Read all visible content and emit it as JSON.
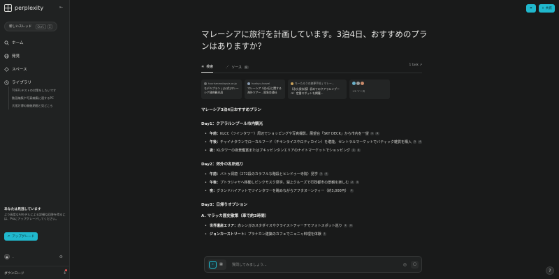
{
  "app": {
    "name": "perplexity"
  },
  "sidebar": {
    "new_thread": {
      "label": "新しいスレッド",
      "kbd": [
        "Ctrl",
        "I"
      ]
    },
    "nav": [
      {
        "label": "ホーム",
        "icon": "search-icon"
      },
      {
        "label": "発見",
        "icon": "globe-icon"
      },
      {
        "label": "スペース",
        "icon": "spaces-icon"
      },
      {
        "label": "ライブラリ",
        "icon": "library-icon"
      }
    ],
    "library_items": [
      "TOEFLテストの対策をしたいです",
      "動画編集や写真編集に適するPC",
      "大阪万博の開催期間と見どころ"
    ],
    "promo": {
      "title": "あなたは見逃しています",
      "body": "より高度なAIモデルによる詳細な回答を得るには、Proにアップグレードしてください。",
      "button": "アップグレード"
    },
    "download_label": "ダウンロード"
  },
  "header": {
    "share_label": "共有"
  },
  "thread": {
    "question": "マレーシアに旅行を計画しています。3泊4日、おすすめのプランはありますか？",
    "tabs": [
      {
        "label": "検索",
        "active": true
      },
      {
        "label": "ソース",
        "count": "8",
        "active": false
      }
    ],
    "tasks_label": "1 task",
    "sources": [
      {
        "domain": "tourismmalaysia.or.jp",
        "title": "モデルプラン | [公式]マレーシア政府観光局"
      },
      {
        "domain": "hankyu-travel",
        "title": "マレーシア 3泊4日に関する海外ツアー - 阪急交通社"
      },
      {
        "domain": "ちーたろうの旅夢手帖 | マレー...",
        "title": "【永久保存版】初めてのクアラルンプール！定番スポットを網羅..."
      }
    ],
    "sources_more": "+5 ソース"
  },
  "answer": {
    "title": "マレーシア3泊4日おすすめプラン",
    "day1": {
      "heading": "Day1：クアラルンプール市内観光",
      "items": [
        {
          "bold": "午前：",
          "text": "KLCC（ツインタワー）周辺でショッピングや写真撮影。展望台「SKY DECK」から市内を一望",
          "cites": [
            "1",
            "4"
          ]
        },
        {
          "bold": "午後：",
          "text": "チャイナタウンでローカルフード（チキンライスやロティカイン）を堪能。セントラルマーケットでバティック雑貨を購入",
          "cites": [
            "3",
            "4"
          ]
        },
        {
          "bold": "夜：",
          "text": "KLタワーの夜景鑑賞またはブキッビンタンエリアのナイトマーケットでショッピング",
          "cites": [
            "3",
            "4"
          ]
        }
      ]
    },
    "day2": {
      "heading": "Day2：郊外の名所巡り",
      "items": [
        {
          "bold": "午前：",
          "text": "バトゥ洞窟（272段のカラフルな階段とヒンドゥー寺院）見学",
          "cites": [
            "3",
            "4"
          ]
        },
        {
          "bold": "午後：",
          "text": "プトラジャヤへ移動しピンクモスク見学。湖上クルーズで行政都市の景観を楽しむ",
          "cites": [
            "2",
            "5"
          ]
        },
        {
          "bold": "夜：",
          "text": "グランドハイアットでツインタワーを眺めながらアフタヌーンティー（約3,000円）",
          "cites": [
            "2"
          ]
        }
      ]
    },
    "day3": {
      "heading": "Day3：日帰りオプション",
      "subheading": "A. マラッカ歴史散策（車で約2時間）",
      "items": [
        {
          "bold": "世界遺産エリア：",
          "text": "赤レンガのスタダイスやクライストチャーチでフォトスポット巡り",
          "cites": [
            "1",
            "4"
          ]
        },
        {
          "bold": "ジョンカーストリート：",
          "text": "プラナカン建築のカフェでニョニャ料理を体験",
          "cites": [
            "1"
          ]
        }
      ]
    }
  },
  "composer": {
    "placeholder": "質問してみましょう..."
  },
  "colors": {
    "accent": "#20b8cd",
    "background": "#191a1a",
    "sidebar": "#202222"
  }
}
